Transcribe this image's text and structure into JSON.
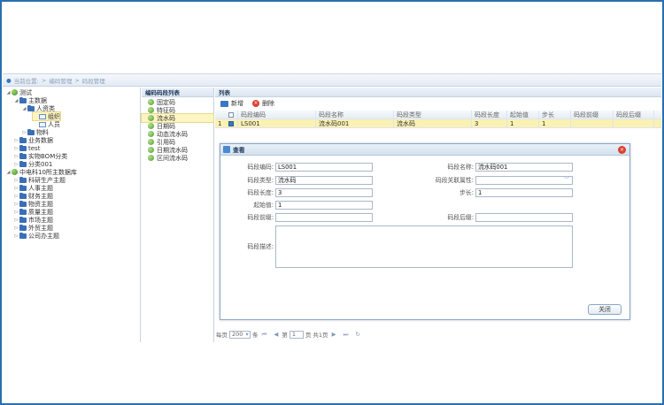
{
  "breadcrumb": {
    "prefix": "当前位置:",
    "items": [
      "编码管理",
      "码段管理"
    ],
    "separator": ">"
  },
  "tree": [
    {
      "label": "测试",
      "level": 0,
      "arrow": "◢",
      "icon": "globe"
    },
    {
      "label": "主数据",
      "level": 1,
      "arrow": "◢",
      "icon": "folder"
    },
    {
      "label": "人资类",
      "level": 2,
      "arrow": "◢",
      "icon": "folder"
    },
    {
      "label": "组织",
      "level": 3,
      "arrow": "",
      "icon": "list",
      "selected": true
    },
    {
      "label": "人员",
      "level": 3,
      "arrow": "",
      "icon": "list"
    },
    {
      "label": "物料",
      "level": 2,
      "arrow": "▷",
      "icon": "folder"
    },
    {
      "label": "业务数据",
      "level": 1,
      "arrow": "▷",
      "icon": "folder"
    },
    {
      "label": "test",
      "level": 1,
      "arrow": "▷",
      "icon": "folder"
    },
    {
      "label": "实物BOM分类",
      "level": 1,
      "arrow": "▷",
      "icon": "folder"
    },
    {
      "label": "分类001",
      "level": 1,
      "arrow": "▷",
      "icon": "folder"
    },
    {
      "label": "中电科10所主数据库",
      "level": 0,
      "arrow": "◢",
      "icon": "globe"
    },
    {
      "label": "科研生产主题",
      "level": 1,
      "arrow": "▷",
      "icon": "folder"
    },
    {
      "label": "人事主题",
      "level": 1,
      "arrow": "▷",
      "icon": "folder"
    },
    {
      "label": "财务主题",
      "level": 1,
      "arrow": "▷",
      "icon": "folder"
    },
    {
      "label": "物资主题",
      "level": 1,
      "arrow": "▷",
      "icon": "folder"
    },
    {
      "label": "质量主题",
      "level": 1,
      "arrow": "▷",
      "icon": "folder"
    },
    {
      "label": "市场主题",
      "level": 1,
      "arrow": "▷",
      "icon": "folder"
    },
    {
      "label": "外贸主题",
      "level": 1,
      "arrow": "▷",
      "icon": "folder"
    },
    {
      "label": "公司办主题",
      "level": 1,
      "arrow": "▷",
      "icon": "folder"
    }
  ],
  "segment_panel": {
    "title": "编码码段列表",
    "items": [
      "固定码",
      "特征码",
      "流水码",
      "日期码",
      "动态流水码",
      "引用码",
      "日期流水码",
      "区间流水码"
    ],
    "selected_index": 2
  },
  "list_panel": {
    "title": "列表",
    "add_label": "新增",
    "delete_label": "删除",
    "columns": [
      "码段编码",
      "码段名称",
      "码段类型",
      "码段长度",
      "起始值",
      "步长",
      "码段前缀",
      "码段后缀"
    ],
    "rows": [
      {
        "index": "1",
        "checked": true,
        "cells": [
          "LS001",
          "流水码001",
          "流水码",
          "3",
          "1",
          "1",
          "",
          ""
        ]
      }
    ]
  },
  "pager": {
    "per_page_label": "每页",
    "page_size": "200",
    "unit": "条",
    "page_prefix": "第",
    "current_page": "1",
    "page_suffix": "页 共1页"
  },
  "dialog": {
    "title": "查看",
    "fields": {
      "code_label": "码段编码:",
      "code_value": "LS001",
      "name_label": "码段名称:",
      "name_value": "流水码001",
      "type_label": "码段类型:",
      "type_value": "流水码",
      "attr_label": "码段关联属性:",
      "attr_value": "",
      "length_label": "码段长度:",
      "length_value": "3",
      "step_label": "步长:",
      "step_value": "1",
      "start_label": "起始值:",
      "start_value": "1",
      "prefix_label": "码段前缀:",
      "prefix_value": "",
      "suffix_label": "码段后缀:",
      "suffix_value": "",
      "desc_label": "码段描述:",
      "desc_value": ""
    },
    "close_label": "关闭"
  }
}
